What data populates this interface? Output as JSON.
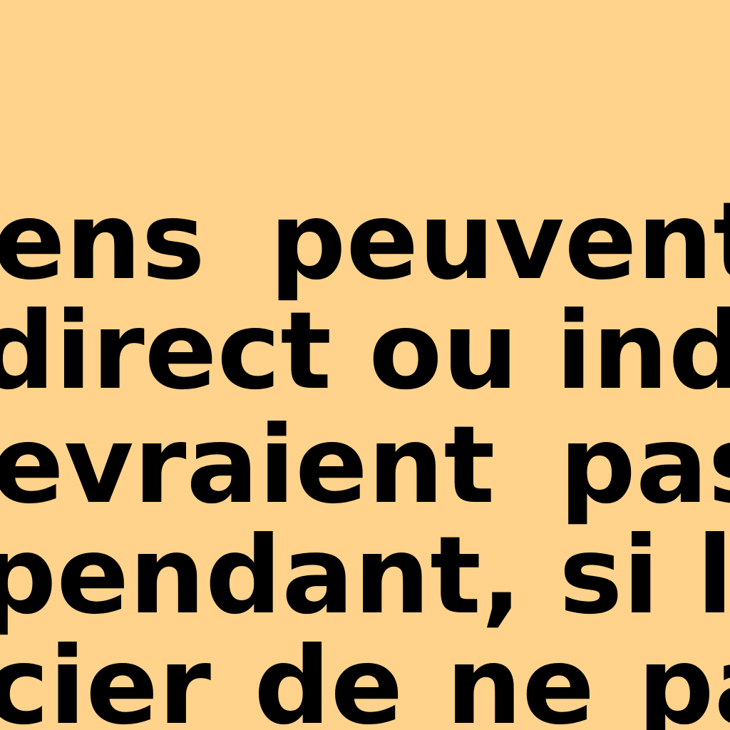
{
  "document": {
    "lines": [
      "ens  peuvent  co",
      "direct ou indirec",
      "evraient  pas  m",
      "pendant, si les a",
      "cier de ne pas re"
    ]
  },
  "colors": {
    "background": "#FFD38B",
    "text": "#000000"
  }
}
